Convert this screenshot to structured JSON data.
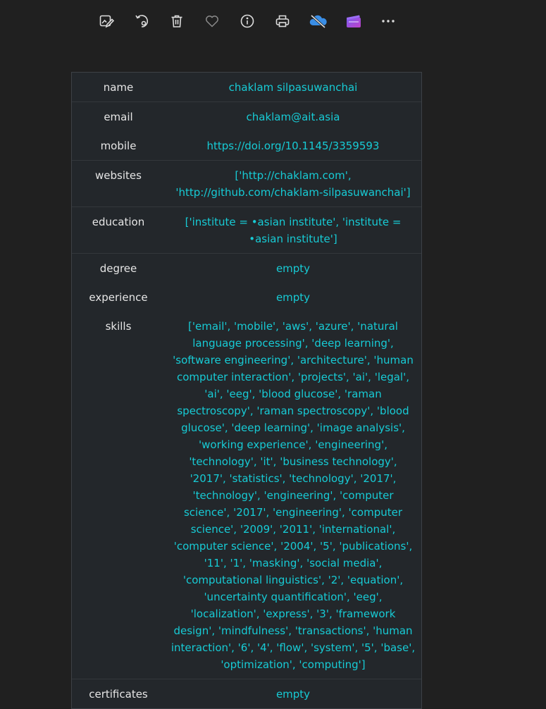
{
  "toolbar": {
    "items": [
      {
        "name": "edit-image-icon",
        "label": "Edit image"
      },
      {
        "name": "rotate-icon",
        "label": "Rotate"
      },
      {
        "name": "delete-icon",
        "label": "Delete"
      },
      {
        "name": "favorite-icon",
        "label": "Favorite"
      },
      {
        "name": "info-icon",
        "label": "File info"
      },
      {
        "name": "print-icon",
        "label": "Print"
      },
      {
        "name": "cloud-off-icon",
        "label": "OneDrive"
      },
      {
        "name": "clipchamp-icon",
        "label": "Clipchamp"
      },
      {
        "name": "more-icon",
        "label": "See more"
      }
    ]
  },
  "table": {
    "rows": [
      {
        "key": "name",
        "value": "chaklam silpasuwanchai"
      },
      {
        "key": "email",
        "value": "chaklam@ait.asia"
      },
      {
        "key": "mobile",
        "value": "https://doi.org/10.1145/3359593"
      },
      {
        "key": "websites",
        "value": "['http://chaklam.com', 'http://github.com/chaklam-silpasuwanchai']"
      },
      {
        "key": "education",
        "value": "['institute = •asian institute', 'institute = •asian institute']"
      },
      {
        "key": "degree",
        "value": "empty"
      },
      {
        "key": "experience",
        "value": "empty"
      },
      {
        "key": "skills",
        "value": "['email', 'mobile', 'aws', 'azure', 'natural language processing', 'deep learning', 'software engineering', 'architecture', 'human computer interaction', 'projects', 'ai', 'legal', 'ai', 'eeg', 'blood glucose', 'raman spectroscopy', 'raman spectroscopy', 'blood glucose', 'deep learning', 'image analysis', 'working experience', 'engineering', 'technology', 'it', 'business technology', '2017', 'statistics', 'technology', '2017', 'technology', 'engineering', 'computer science', '2017', 'engineering', 'computer science', '2009', '2011', 'international', 'computer science', '2004', '5', 'publications', '11', '1', 'masking', 'social media', 'computational linguistics', '2', 'equation', 'uncertainty quantification', 'eeg', 'localization', 'express', '3', 'framework design', 'mindfulness', 'transactions', 'human interaction', '6', '4', 'flow', 'system', '5', 'base', 'optimization', 'computing']"
      },
      {
        "key": "certificates",
        "value": "empty"
      }
    ]
  }
}
